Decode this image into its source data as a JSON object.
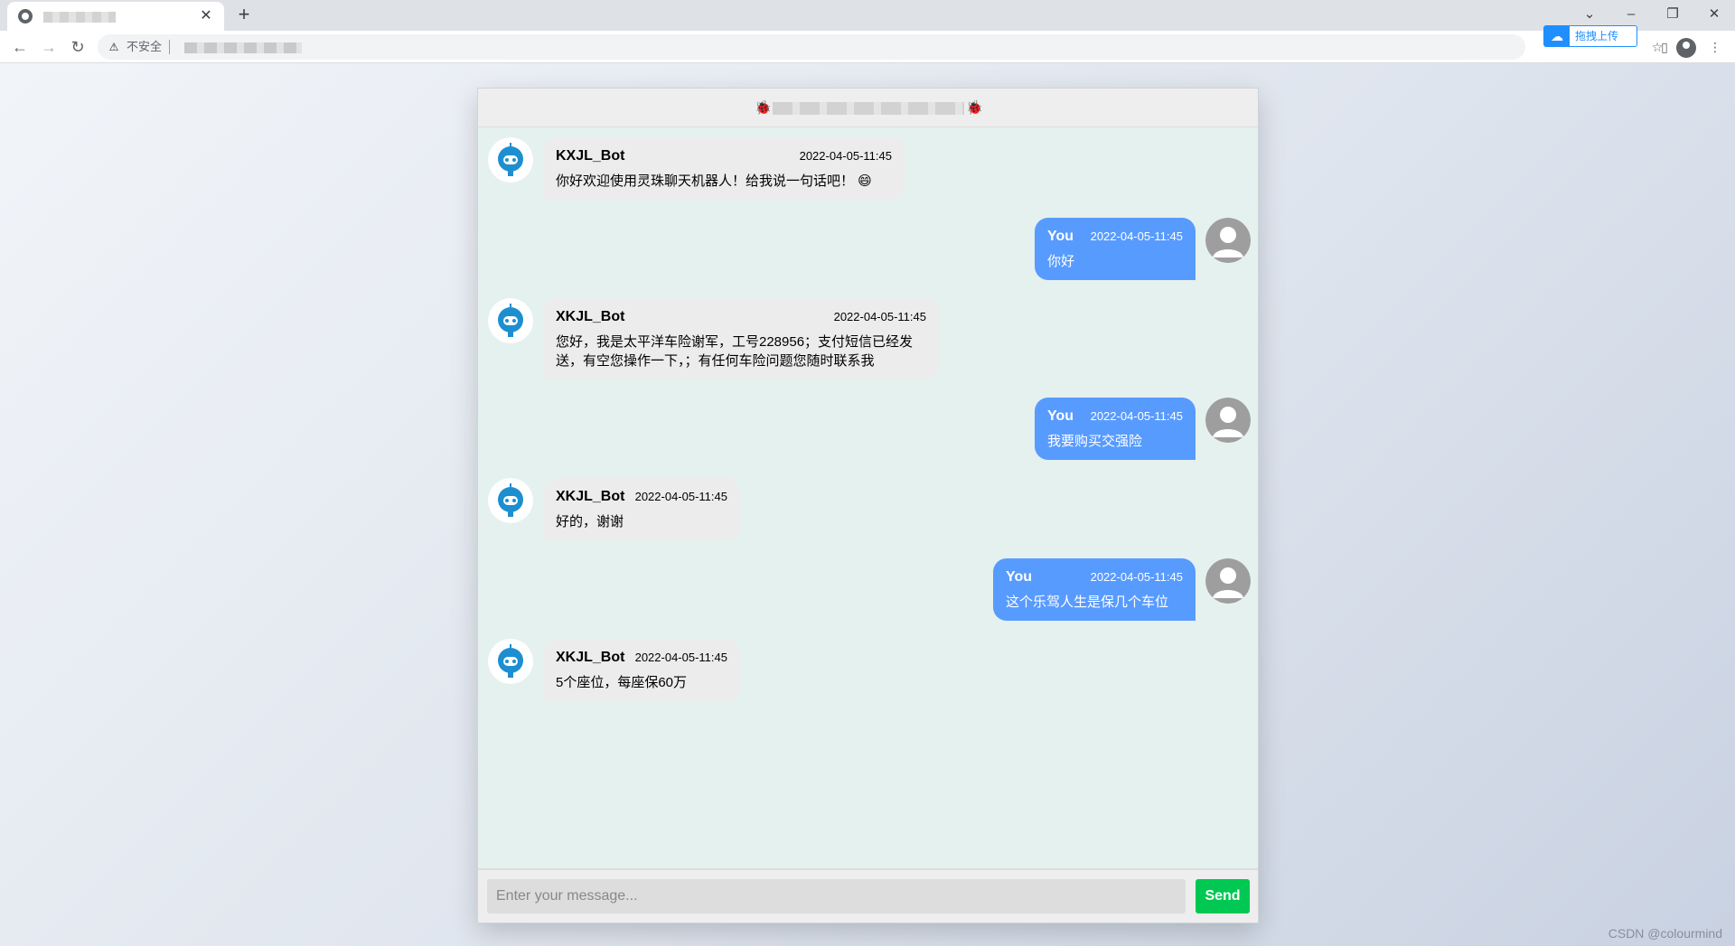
{
  "browser": {
    "tab_close": "✕",
    "new_tab": "+",
    "omnibox_warning": "不安全",
    "baidu_upload_label": "拖拽上传",
    "window_controls": {
      "dropdown": "⌄",
      "minimize": "–",
      "restore": "❐",
      "close": "✕"
    }
  },
  "chat": {
    "header_icon_left": "🐞",
    "header_icon_right": "🐞",
    "messages": [
      {
        "sender": "KXJL_Bot",
        "time": "2022-04-05-11:45",
        "text": "你好欢迎使用灵珠聊天机器人！给我说一句话吧！ 😄",
        "side": "bot"
      },
      {
        "sender": "You",
        "time": "2022-04-05-11:45",
        "text": "你好",
        "side": "user"
      },
      {
        "sender": "XKJL_Bot",
        "time": "2022-04-05-11:45",
        "text": "您好，我是太平洋车险谢军，工号228956；支付短信已经发送，有空您操作一下，；有任何车险问题您随时联系我",
        "side": "bot"
      },
      {
        "sender": "You",
        "time": "2022-04-05-11:45",
        "text": "我要购买交强险",
        "side": "user"
      },
      {
        "sender": "XKJL_Bot",
        "time": "2022-04-05-11:45",
        "text": "好的，谢谢",
        "side": "bot"
      },
      {
        "sender": "You",
        "time": "2022-04-05-11:45",
        "text": "这个乐驾人生是保几个车位",
        "side": "user"
      },
      {
        "sender": "XKJL_Bot",
        "time": "2022-04-05-11:45",
        "text": "5个座位，每座保60万",
        "side": "bot"
      }
    ],
    "input": {
      "placeholder": "Enter your message...",
      "value": ""
    },
    "send_label": "Send"
  },
  "watermark": "CSDN @colourmind",
  "colors": {
    "user_bubble": "#589bff",
    "bot_bubble": "#ececec",
    "send_button": "#00c853",
    "chat_bg": "#e5f1ee"
  }
}
